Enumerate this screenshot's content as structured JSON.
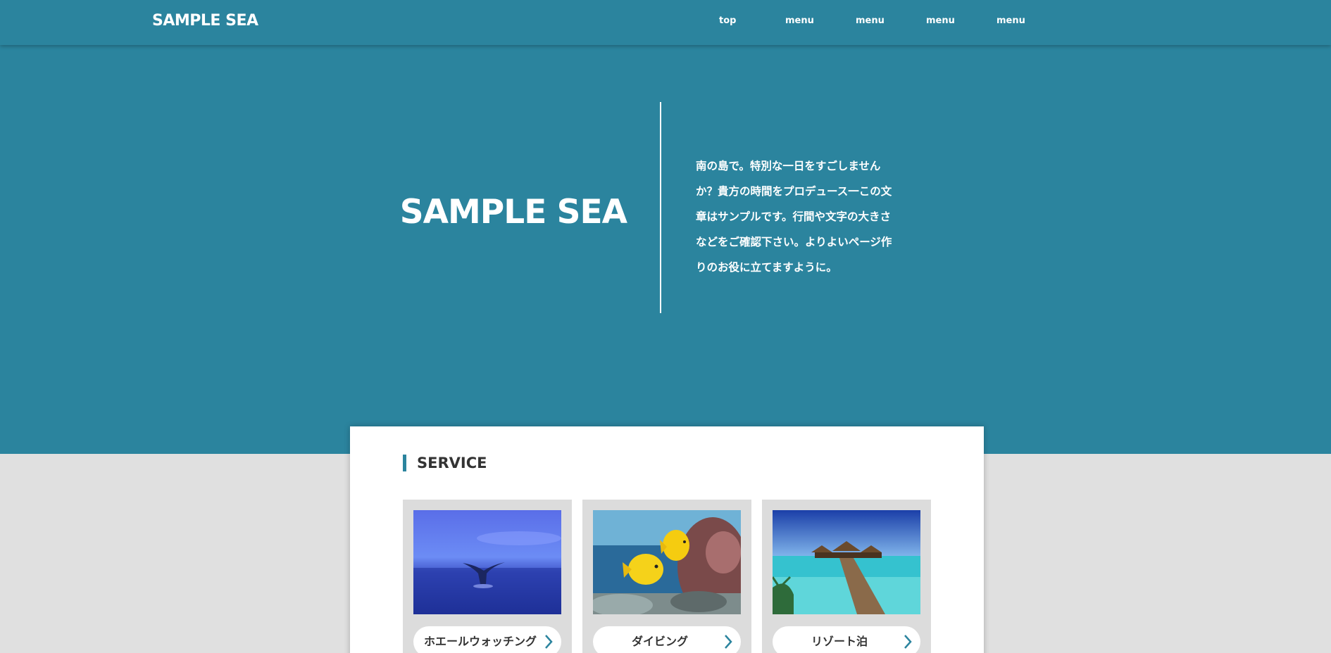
{
  "header": {
    "logo": "SAMPLE SEA",
    "nav": [
      "top",
      "menu",
      "menu",
      "menu",
      "menu"
    ]
  },
  "hero": {
    "title": "SAMPLE SEA",
    "lines": [
      "南の島で。特別な一日をすごしません",
      "か？貴方の時間をプロデュース一この文",
      "章はサンプルです。行間や文字の大きさ",
      "などをご確認下さい。よりよいページ作",
      "りのお役に立てますように。"
    ]
  },
  "service": {
    "title": "SERVICE",
    "items": [
      {
        "label": "ホエールウォッチング",
        "icon": "whale-tail-photo"
      },
      {
        "label": "ダイビング",
        "icon": "tropical-fish-photo"
      },
      {
        "label": "リゾート泊",
        "icon": "overwater-bungalow-photo"
      }
    ]
  },
  "colors": {
    "brand": "#2b849e",
    "page_bg": "#e0e0e0",
    "card_bg": "#ffffff"
  }
}
